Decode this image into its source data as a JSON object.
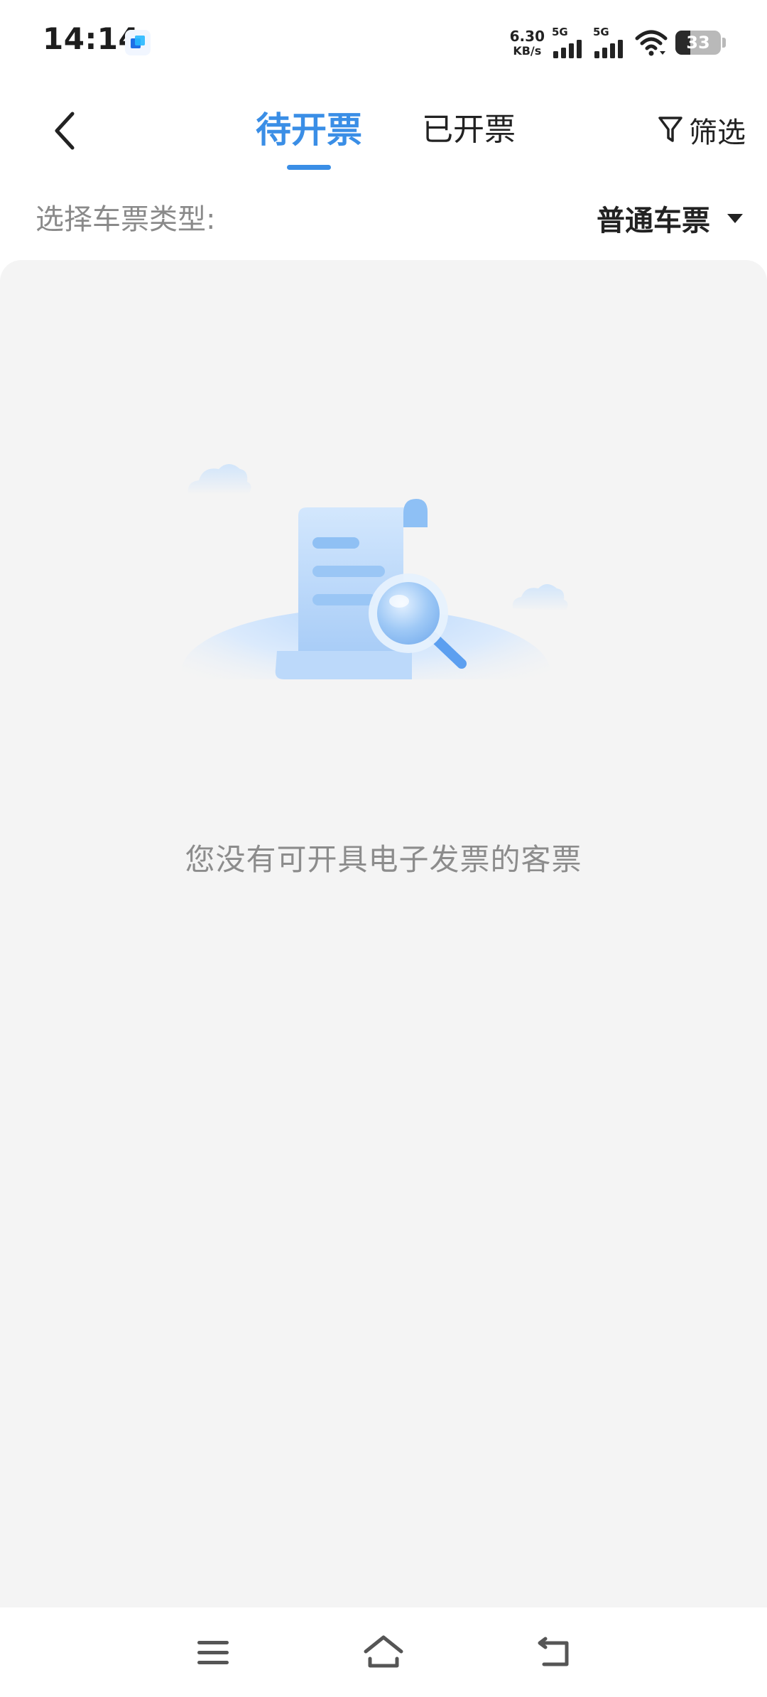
{
  "status_bar": {
    "time": "14:14",
    "net_speed_value": "6.30",
    "net_speed_unit": "KB/s",
    "sim1_label": "5G",
    "sim2_label": "5G",
    "battery_level": 33,
    "battery_text": "33"
  },
  "header": {
    "back_icon": "chevron-left-icon",
    "tabs": [
      {
        "label": "待开票",
        "active": true
      },
      {
        "label": "已开票",
        "active": false
      }
    ],
    "filter_label": "筛选",
    "filter_icon": "funnel-icon",
    "accent_color": "#3a8ee6"
  },
  "ticket_type": {
    "label": "选择车票类型:",
    "selected": "普通车票"
  },
  "empty_state": {
    "illustration": "document-magnifier-illustration",
    "message": "您没有可开具电子发票的客票"
  },
  "nav_bar": {
    "icons": [
      "menu-icon",
      "home-icon",
      "back-icon"
    ]
  }
}
